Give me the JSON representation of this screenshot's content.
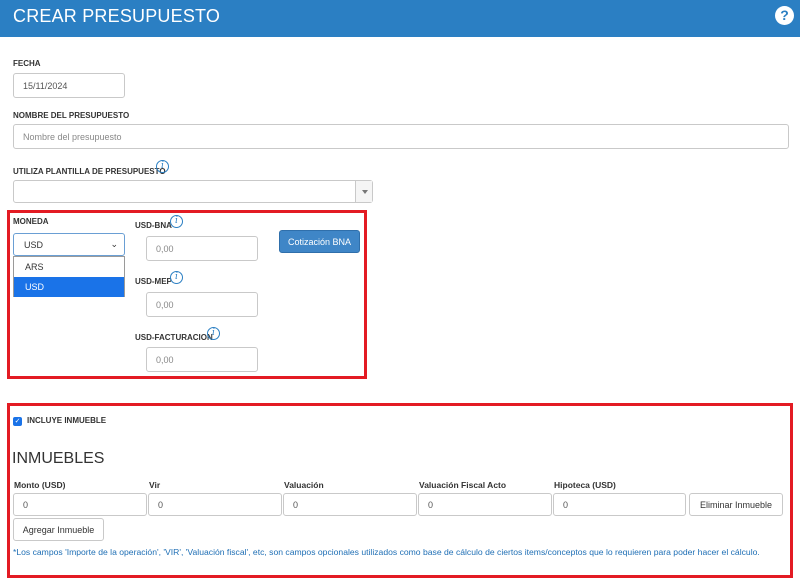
{
  "header": {
    "title": "CREAR PRESUPUESTO",
    "help_glyph": "?"
  },
  "fecha": {
    "label": "FECHA",
    "value": "15/11/2024"
  },
  "nombre": {
    "label": "NOMBRE DEL PRESUPUESTO",
    "placeholder": "Nombre del presupuesto"
  },
  "plantilla": {
    "label": "UTILIZA PLANTILLA DE PRESUPUESTO",
    "value": ""
  },
  "info_glyph": "i",
  "moneda": {
    "label": "MONEDA",
    "value": "USD",
    "options": [
      "ARS",
      "USD"
    ],
    "selected": "USD"
  },
  "usd_bna": {
    "label": "USD-BNA",
    "placeholder": "0,00"
  },
  "usd_mep": {
    "label": "USD-MEP",
    "placeholder": "0,00"
  },
  "usd_facturacion": {
    "label": "USD-FACTURACION",
    "placeholder": "0,00"
  },
  "cotizacion_button": "Cotización BNA",
  "incluye_inmueble": {
    "label": "INCLUYE INMUEBLE",
    "checked": true
  },
  "inmuebles": {
    "title": "INMUEBLES",
    "columns": [
      "Monto (USD)",
      "Vir",
      "Valuación",
      "Valuación Fiscal Acto",
      "Hipoteca (USD)"
    ],
    "values": [
      "0",
      "0",
      "0",
      "0",
      "0"
    ],
    "remove_button": "Eliminar Inmueble",
    "add_button": "Agregar Inmueble"
  },
  "note": "*Los campos 'Importe de la operación', 'VIR', 'Valuación fiscal', etc, son campos opcionales utilizados como base de cálculo de ciertos items/conceptos que lo requieren para poder hacer el cálculo.",
  "colors": {
    "header": "#2b7fc3",
    "highlight": "#e31b23",
    "accent": "#1a73e8",
    "note": "#1f6fb5"
  }
}
